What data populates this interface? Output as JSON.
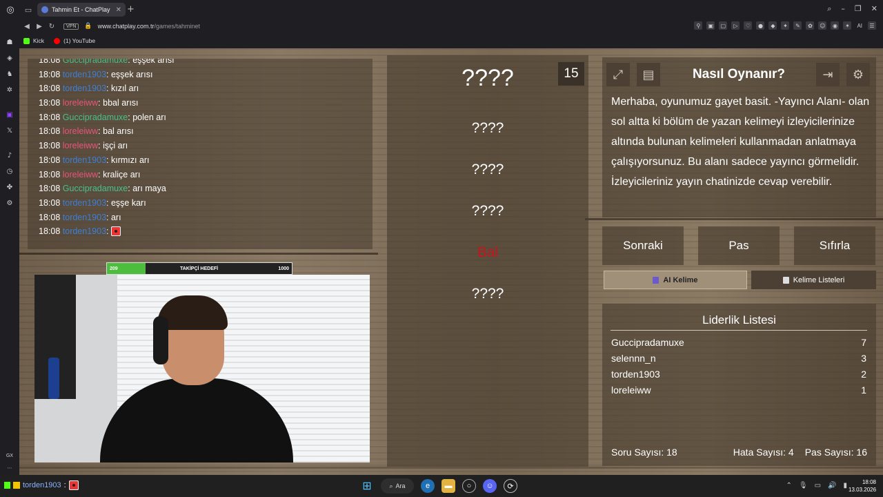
{
  "browser": {
    "tab_title": "Tahmin Et - ChatPlay",
    "url_host": "www.chatplay.com.tr",
    "url_path": "/games/tahminet",
    "vpn_label": "VPN",
    "ai_label": "AI",
    "bookmarks": [
      "Kick",
      "(1) YouTube"
    ],
    "sidebar_bottom": "GX"
  },
  "chat": [
    {
      "time": "18:08",
      "user": "Guccipradamuxe",
      "color": "#46c18a",
      "msg": ": eşşek arısı"
    },
    {
      "time": "18:08",
      "user": "torden1903",
      "color": "#3d7fd6",
      "msg": ": eşşek arısı"
    },
    {
      "time": "18:08",
      "user": "torden1903",
      "color": "#3d7fd6",
      "msg": ": kızıl arı"
    },
    {
      "time": "18:08",
      "user": "loreleiww",
      "color": "#e8557a",
      "msg": ": bbal arısı"
    },
    {
      "time": "18:08",
      "user": "Guccipradamuxe",
      "color": "#46c18a",
      "msg": ": polen arı"
    },
    {
      "time": "18:08",
      "user": "loreleiww",
      "color": "#e8557a",
      "msg": ": bal arısı"
    },
    {
      "time": "18:08",
      "user": "loreleiww",
      "color": "#e8557a",
      "msg": ": işçi arı"
    },
    {
      "time": "18:08",
      "user": "torden1903",
      "color": "#3d7fd6",
      "msg": ": kırmızı arı"
    },
    {
      "time": "18:08",
      "user": "loreleiww",
      "color": "#e8557a",
      "msg": ": kraliçe arı"
    },
    {
      "time": "18:08",
      "user": "Guccipradamuxe",
      "color": "#46c18a",
      "msg": ": arı maya"
    },
    {
      "time": "18:08",
      "user": "torden1903",
      "color": "#3d7fd6",
      "msg": ": eşşe karı"
    },
    {
      "time": "18:08",
      "user": "torden1903",
      "color": "#3d7fd6",
      "msg": ": arı"
    },
    {
      "time": "18:08",
      "user": "torden1903",
      "color": "#3d7fd6",
      "msg": ": ",
      "emote": true
    }
  ],
  "follow_goal": {
    "current": "209",
    "label": "TAKİPÇİ HEDEFİ",
    "target": "1000",
    "progress": 0.209
  },
  "words": {
    "timer": "15",
    "items": [
      {
        "text": "????",
        "size": "big"
      },
      {
        "text": "????",
        "size": "small"
      },
      {
        "text": "????",
        "size": "small"
      },
      {
        "text": "????",
        "size": "small"
      },
      {
        "text": "Bal",
        "size": "small",
        "highlight": true
      },
      {
        "text": "????",
        "size": "small"
      }
    ]
  },
  "howto": {
    "title": "Nasıl Oynanır?",
    "text": "Merhaba, oyunumuz gayet basit. -Yayıncı Alanı- olan sol altta ki bölüm de yazan kelimeyi izleyicilerinize altında bulunan kelimeleri kullanmadan anlatmaya çalışıyorsunuz. Bu alanı sadece yayıncı görmelidir. İzleyicileriniz yayın chatinizde cevap verebilir."
  },
  "buttons": {
    "next": "Sonraki",
    "pass": "Pas",
    "reset": "Sıfırla",
    "ai_word": "AI Kelime",
    "word_lists": "Kelime Listeleri"
  },
  "leaderboard": {
    "title": "Liderlik Listesi",
    "rows": [
      {
        "name": "Guccipradamuxe",
        "score": "7"
      },
      {
        "name": "selennn_n",
        "score": "3"
      },
      {
        "name": "torden1903",
        "score": "2"
      },
      {
        "name": "loreleiww",
        "score": "1"
      }
    ],
    "stats": {
      "questions": "Soru Sayısı: 18",
      "errors": "Hata Sayısı: 4",
      "passes": "Pas Sayısı: 16"
    }
  },
  "taskbar": {
    "chat_user": "torden1903",
    "chat_sep": ":",
    "search_label": "Ara",
    "time": "18:08",
    "date": "13.03.2026"
  }
}
